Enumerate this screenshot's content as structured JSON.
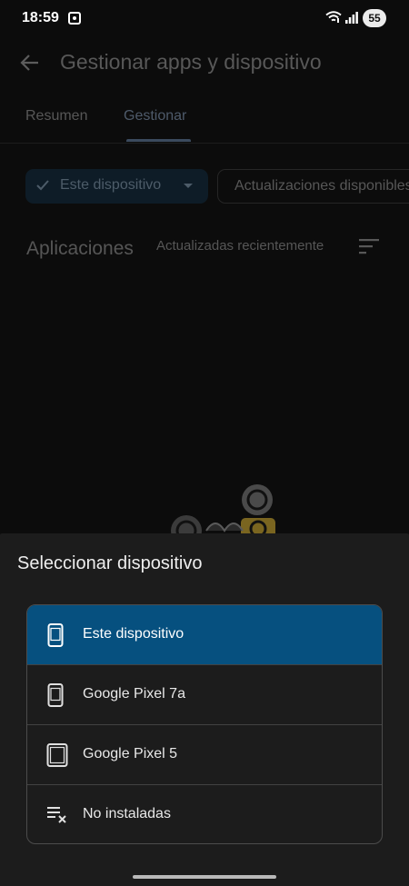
{
  "status_bar": {
    "time": "18:59",
    "battery": "55",
    "icons": [
      "screen-record-icon",
      "wifi-icon",
      "signal-icon"
    ]
  },
  "app_bar": {
    "title": "Gestionar apps y dispositivo",
    "back_icon": "back-arrow-icon"
  },
  "tabs": [
    {
      "label": "Resumen",
      "selected": false
    },
    {
      "label": "Gestionar",
      "selected": true
    }
  ],
  "filters": {
    "device_chip": "Este dispositivo",
    "updates_chip": "Actualizaciones disponibles"
  },
  "apps_section": {
    "header": "Aplicaciones",
    "sort_label": "Actualizadas recientemente"
  },
  "sheet": {
    "title": "Seleccionar dispositivo",
    "items": [
      {
        "label": "Este dispositivo",
        "icon": "phone-icon",
        "selected": true
      },
      {
        "label": "Google Pixel 7a",
        "icon": "phone-icon",
        "selected": false
      },
      {
        "label": "Google Pixel 5",
        "icon": "tablet-icon",
        "selected": false
      },
      {
        "label": "No instaladas",
        "icon": "list-remove-icon",
        "selected": false
      }
    ]
  },
  "colors": {
    "selected_item": "#06507f",
    "sheet_background": "#1c1c1c",
    "scrim_background": "#0c0c0c"
  }
}
